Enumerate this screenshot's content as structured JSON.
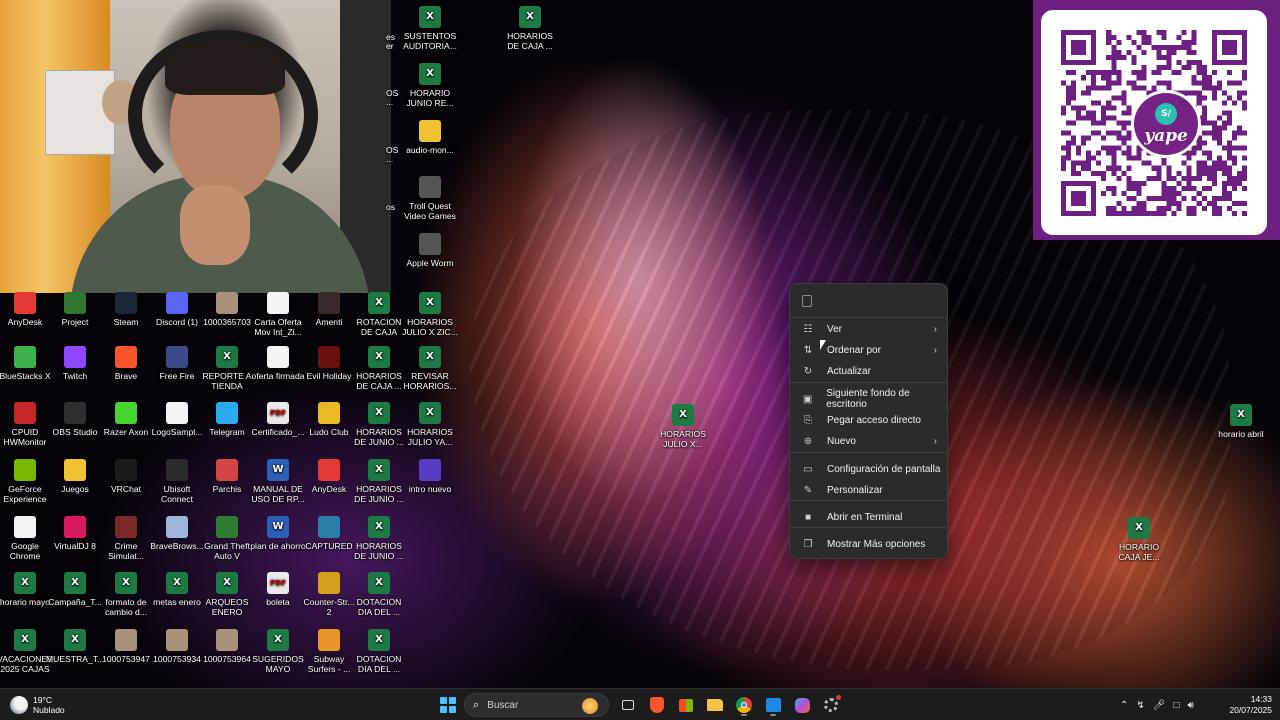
{
  "context_menu": {
    "items": [
      {
        "label": "Ver",
        "icon": "grid-icon",
        "submenu": true
      },
      {
        "label": "Ordenar por",
        "icon": "sort-icon",
        "submenu": true
      },
      {
        "label": "Actualizar",
        "icon": "refresh-icon",
        "submenu": false
      },
      {
        "label": "Siguiente fondo de escritorio",
        "icon": "wallpaper-icon",
        "submenu": false
      },
      {
        "label": "Pegar acceso directo",
        "icon": "shortcut-icon",
        "submenu": false
      },
      {
        "label": "Nuevo",
        "icon": "plus-circle-icon",
        "submenu": true
      },
      {
        "label": "Configuración de pantalla",
        "icon": "display-icon",
        "submenu": false
      },
      {
        "label": "Personalizar",
        "icon": "brush-icon",
        "submenu": false
      },
      {
        "label": "Abrir en Terminal",
        "icon": "terminal-icon",
        "submenu": false
      },
      {
        "label": "Mostrar Más opciones",
        "icon": "more-options-icon",
        "submenu": false
      }
    ]
  },
  "desktop_icons": {
    "top_column": [
      {
        "label": "SUSTENTOS AUDITORIA...",
        "type": "excel"
      },
      {
        "label": "HORARIOS DE CAJA ...",
        "type": "excel"
      },
      {
        "label": "HORARIO JUNIO RE...",
        "type": "excel"
      },
      {
        "label": "audio-mon...",
        "type": "folder"
      },
      {
        "label": "Troll Quest Video Games",
        "type": "game"
      },
      {
        "label": "Apple Worm",
        "type": "game"
      }
    ],
    "partial_labels": [
      "es",
      "er",
      "OS",
      "...",
      "OS",
      "...",
      "os"
    ],
    "grid": [
      {
        "label": "AnyDesk",
        "type": "app",
        "color": "#e53935"
      },
      {
        "label": "Project",
        "type": "app",
        "color": "#31752f"
      },
      {
        "label": "Steam",
        "type": "app",
        "color": "#1b2838"
      },
      {
        "label": "Discord (1)",
        "type": "app",
        "color": "#5865f2"
      },
      {
        "label": "1000365703",
        "type": "photo"
      },
      {
        "label": "Carta Oferta Mov Int_Zi...",
        "type": "doc"
      },
      {
        "label": "Amenti",
        "type": "app",
        "color": "#3a2a2a"
      },
      {
        "label": "ROTACION DE CAJA",
        "type": "excel"
      },
      {
        "label": "HORARIOS JULIO X ZIC...",
        "type": "excel"
      },
      {
        "label": "BlueStacks X",
        "type": "app",
        "color": "#3cb34a"
      },
      {
        "label": "Twitch",
        "type": "app",
        "color": "#9146ff"
      },
      {
        "label": "Brave",
        "type": "app",
        "color": "#fb542b"
      },
      {
        "label": "Free Fire",
        "type": "app",
        "color": "#3d4a8a"
      },
      {
        "label": "REPORTE A TIENDA",
        "type": "excel"
      },
      {
        "label": "oferta firmada",
        "type": "doc"
      },
      {
        "label": "Evil Holiday",
        "type": "app",
        "color": "#6a1010"
      },
      {
        "label": "HORARIOS DE CAJA ...",
        "type": "excel"
      },
      {
        "label": "REVISAR HORARIOS...",
        "type": "excel"
      },
      {
        "label": "CPUID HWMonitor",
        "type": "app",
        "color": "#c62828"
      },
      {
        "label": "OBS Studio",
        "type": "app",
        "color": "#302e31"
      },
      {
        "label": "Razer Axon",
        "type": "app",
        "color": "#44d62c"
      },
      {
        "label": "LogoSampl...",
        "type": "doc"
      },
      {
        "label": "Telegram",
        "type": "app",
        "color": "#2aabee"
      },
      {
        "label": "Certificado_...",
        "type": "pdf"
      },
      {
        "label": "Ludo Club",
        "type": "app",
        "color": "#e8b923"
      },
      {
        "label": "HORARIOS DE JUNIO ...",
        "type": "excel"
      },
      {
        "label": "HORARIOS JULIO YA...",
        "type": "excel"
      },
      {
        "label": "GeForce Experience",
        "type": "app",
        "color": "#76b900"
      },
      {
        "label": "Juegos",
        "type": "folder"
      },
      {
        "label": "VRChat",
        "type": "app",
        "color": "#1a1a1a"
      },
      {
        "label": "Ubisoft Connect",
        "type": "app",
        "color": "#2b2b2b"
      },
      {
        "label": "Parchis",
        "type": "app",
        "color": "#d64545"
      },
      {
        "label": "MANUAL DE USO DE RP...",
        "type": "word"
      },
      {
        "label": "AnyDesk",
        "type": "app",
        "color": "#e53935"
      },
      {
        "label": "HORARIOS DE JUNIO ...",
        "type": "excel"
      },
      {
        "label": "intro nuevo",
        "type": "app",
        "color": "#5a3cc4"
      },
      {
        "label": "Google Chrome",
        "type": "doc"
      },
      {
        "label": "VirtualDJ 8",
        "type": "app",
        "color": "#d81b60"
      },
      {
        "label": "Crime Simulat...",
        "type": "app",
        "color": "#7a2a2a"
      },
      {
        "label": "BraveBrows...",
        "type": "app",
        "color": "#9fb6d8"
      },
      {
        "label": "Grand Theft Auto V",
        "type": "app",
        "color": "#2e7d32"
      },
      {
        "label": "plan de ahorro",
        "type": "word"
      },
      {
        "label": "CAPTURED",
        "type": "app",
        "color": "#2a7fa8"
      },
      {
        "label": "HORARIOS DE JUNIO ...",
        "type": "excel"
      },
      {
        "label": "",
        "type": "none"
      },
      {
        "label": "horario mayo",
        "type": "excel"
      },
      {
        "label": "Campaña_T...",
        "type": "excel"
      },
      {
        "label": "formato de cambio d...",
        "type": "excel"
      },
      {
        "label": "metas enero",
        "type": "excel"
      },
      {
        "label": "ARQUEOS ENERO",
        "type": "excel"
      },
      {
        "label": "boleta",
        "type": "pdf"
      },
      {
        "label": "Counter-Str... 2",
        "type": "app",
        "color": "#d4a017"
      },
      {
        "label": "DOTACION DIA DEL ...",
        "type": "excel"
      },
      {
        "label": "",
        "type": "none"
      },
      {
        "label": "VACACIONES 2025 CAJAS",
        "type": "excel"
      },
      {
        "label": "MUESTRA_T...",
        "type": "excel"
      },
      {
        "label": "1000753947",
        "type": "photo"
      },
      {
        "label": "1000753934",
        "type": "photo"
      },
      {
        "label": "1000753964",
        "type": "photo"
      },
      {
        "label": "SUGERIDOS MAYO",
        "type": "excel"
      },
      {
        "label": "Subway Surfers - ...",
        "type": "app",
        "color": "#e8962a"
      },
      {
        "label": "DOTACION DIA DEL ...",
        "type": "excel"
      },
      {
        "label": "",
        "type": "none"
      }
    ],
    "floating": [
      {
        "label": "HORARIOS JULIO X...",
        "type": "excel"
      },
      {
        "label": "horario abril",
        "type": "excel"
      },
      {
        "label": "HORARIO CAJA JE...",
        "type": "excel"
      }
    ]
  },
  "qr_panel": {
    "brand_badge": "S/",
    "brand_name": "yape",
    "color": "#6e1f82"
  },
  "taskbar": {
    "weather": {
      "temp": "19°C",
      "condition": "Nublado"
    },
    "search_placeholder": "Buscar",
    "apps": [
      "windows-start-icon",
      "task-view-icon",
      "brave-icon",
      "store-icon",
      "file-explorer-icon",
      "chrome-icon",
      "capture-icon",
      "copilot-icon",
      "settings-icon"
    ],
    "clock": {
      "time": "14:33",
      "date": "20/07/2025"
    }
  }
}
